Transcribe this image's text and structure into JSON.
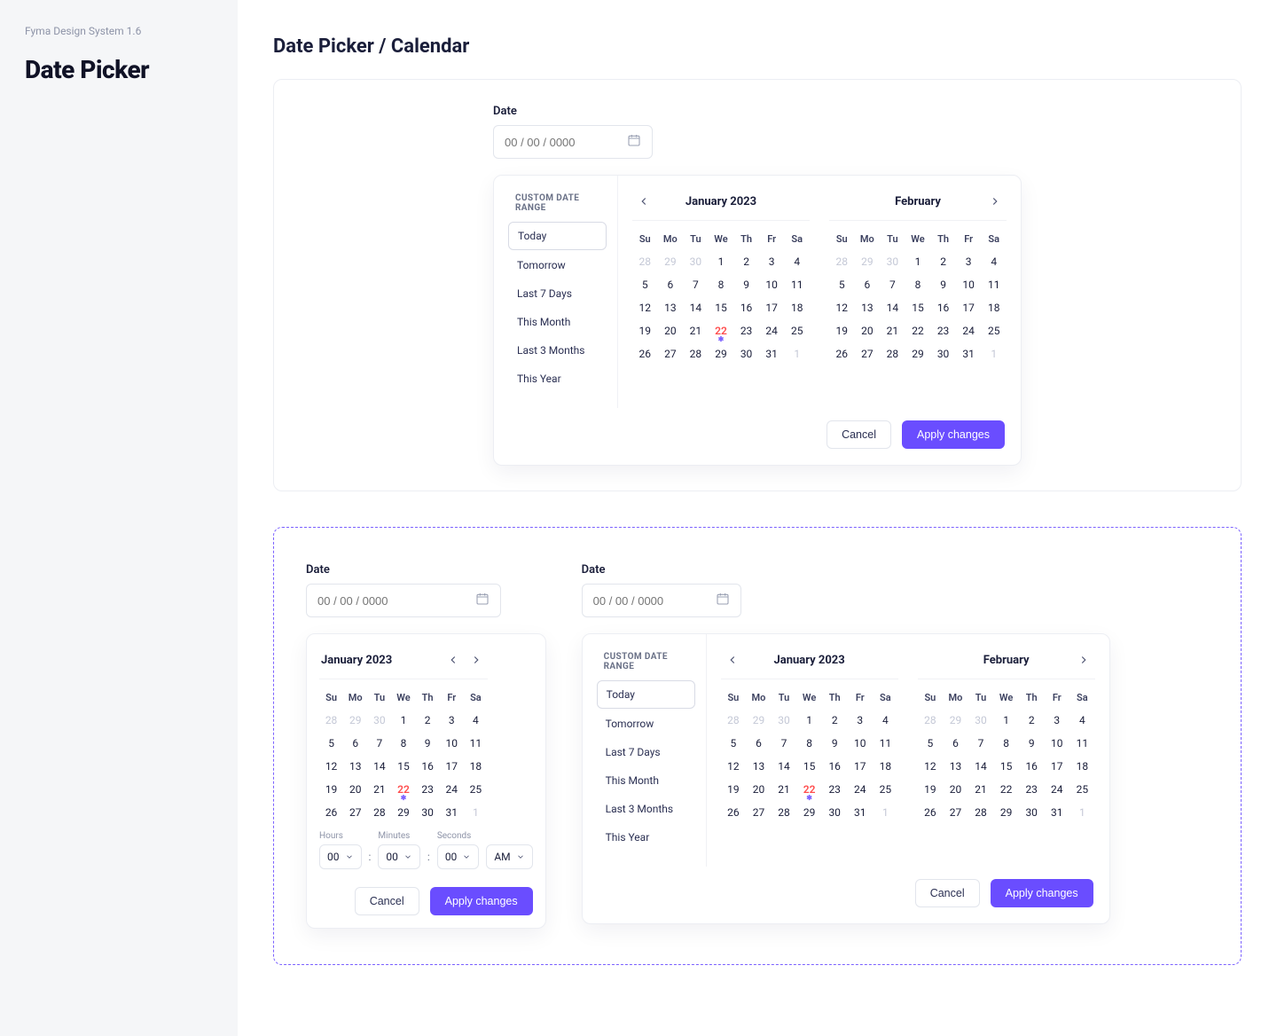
{
  "sidebar": {
    "label": "Fyma Design System 1.6",
    "title": "Date Picker"
  },
  "page": {
    "heading": "Date Picker / Calendar"
  },
  "labels": {
    "date": "Date",
    "placeholder": "00 / 00 / 0000",
    "preset_title": "CUSTOM DATE RANGE",
    "cancel": "Cancel",
    "apply": "Apply changes",
    "hours": "Hours",
    "minutes": "Minutes",
    "seconds": "Seconds"
  },
  "presets": [
    "Today",
    "Tomorrow",
    "Last 7 Days",
    "This Month",
    "Last 3 Months",
    "This Year"
  ],
  "dow": [
    "Su",
    "Mo",
    "Tu",
    "We",
    "Th",
    "Fr",
    "Sa"
  ],
  "month1": {
    "title": "January 2023",
    "weeks": [
      [
        {
          "d": "28",
          "o": true
        },
        {
          "d": "29",
          "o": true
        },
        {
          "d": "30",
          "o": true
        },
        {
          "d": "1"
        },
        {
          "d": "2"
        },
        {
          "d": "3"
        },
        {
          "d": "4"
        }
      ],
      [
        {
          "d": "5"
        },
        {
          "d": "6"
        },
        {
          "d": "7"
        },
        {
          "d": "8"
        },
        {
          "d": "9"
        },
        {
          "d": "10"
        },
        {
          "d": "11"
        }
      ],
      [
        {
          "d": "12"
        },
        {
          "d": "13"
        },
        {
          "d": "14"
        },
        {
          "d": "15"
        },
        {
          "d": "16"
        },
        {
          "d": "17"
        },
        {
          "d": "18"
        }
      ],
      [
        {
          "d": "19"
        },
        {
          "d": "20"
        },
        {
          "d": "21"
        },
        {
          "d": "22",
          "today": true
        },
        {
          "d": "23"
        },
        {
          "d": "24"
        },
        {
          "d": "25"
        }
      ],
      [
        {
          "d": "26"
        },
        {
          "d": "27"
        },
        {
          "d": "28"
        },
        {
          "d": "29"
        },
        {
          "d": "30"
        },
        {
          "d": "31"
        },
        {
          "d": "1",
          "o": true
        }
      ]
    ]
  },
  "month2": {
    "title": "February",
    "weeks": [
      [
        {
          "d": "28",
          "o": true
        },
        {
          "d": "29",
          "o": true
        },
        {
          "d": "30",
          "o": true
        },
        {
          "d": "1"
        },
        {
          "d": "2"
        },
        {
          "d": "3"
        },
        {
          "d": "4"
        }
      ],
      [
        {
          "d": "5"
        },
        {
          "d": "6"
        },
        {
          "d": "7"
        },
        {
          "d": "8"
        },
        {
          "d": "9"
        },
        {
          "d": "10"
        },
        {
          "d": "11"
        }
      ],
      [
        {
          "d": "12"
        },
        {
          "d": "13"
        },
        {
          "d": "14"
        },
        {
          "d": "15"
        },
        {
          "d": "16"
        },
        {
          "d": "17"
        },
        {
          "d": "18"
        }
      ],
      [
        {
          "d": "19"
        },
        {
          "d": "20"
        },
        {
          "d": "21"
        },
        {
          "d": "22"
        },
        {
          "d": "23"
        },
        {
          "d": "24"
        },
        {
          "d": "25"
        }
      ],
      [
        {
          "d": "26"
        },
        {
          "d": "27"
        },
        {
          "d": "28"
        },
        {
          "d": "29"
        },
        {
          "d": "30"
        },
        {
          "d": "31"
        },
        {
          "d": "1",
          "o": true
        }
      ]
    ]
  },
  "time": {
    "hours": "00",
    "minutes": "00",
    "seconds": "00",
    "ampm": "AM"
  }
}
